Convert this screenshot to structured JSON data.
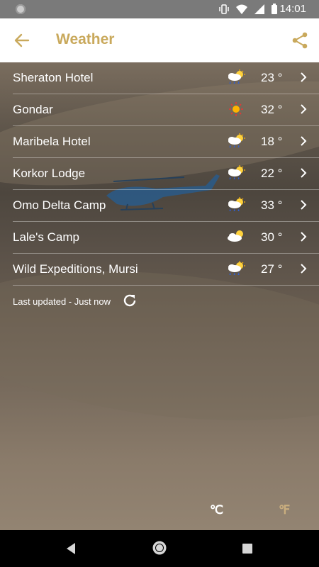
{
  "status_bar": {
    "time": "14:01",
    "icons": [
      "vibrate-icon",
      "wifi-icon",
      "signal-icon",
      "battery-icon"
    ]
  },
  "app_bar": {
    "title": "Weather",
    "back_icon": "arrow-left-icon",
    "share_icon": "share-icon",
    "accent": "#c9a95c"
  },
  "locations": [
    {
      "name": "Sheraton Hotel",
      "icon": "rain-sun-cloud-icon",
      "temp": "23 °"
    },
    {
      "name": "Gondar",
      "icon": "sun-icon",
      "temp": "32 °"
    },
    {
      "name": "Maribela Hotel",
      "icon": "rain-sun-cloud-icon",
      "temp": "18 °"
    },
    {
      "name": "Korkor Lodge",
      "icon": "rain-sun-cloud-icon",
      "temp": "22 °"
    },
    {
      "name": "Omo Delta Camp",
      "icon": "rain-sun-cloud-icon",
      "temp": "33 °"
    },
    {
      "name": "Lale's Camp",
      "icon": "partly-cloudy-icon",
      "temp": "30 °"
    },
    {
      "name": "Wild Expeditions, Mursi",
      "icon": "rain-sun-cloud-icon",
      "temp": "27 °"
    }
  ],
  "last_updated": "Last updated - Just now",
  "units": {
    "celsius": "℃",
    "fahrenheit": "℉",
    "selected": "celsius"
  },
  "nav": {
    "back": "nav-back-icon",
    "home": "nav-home-icon",
    "recent": "nav-recent-icon"
  }
}
